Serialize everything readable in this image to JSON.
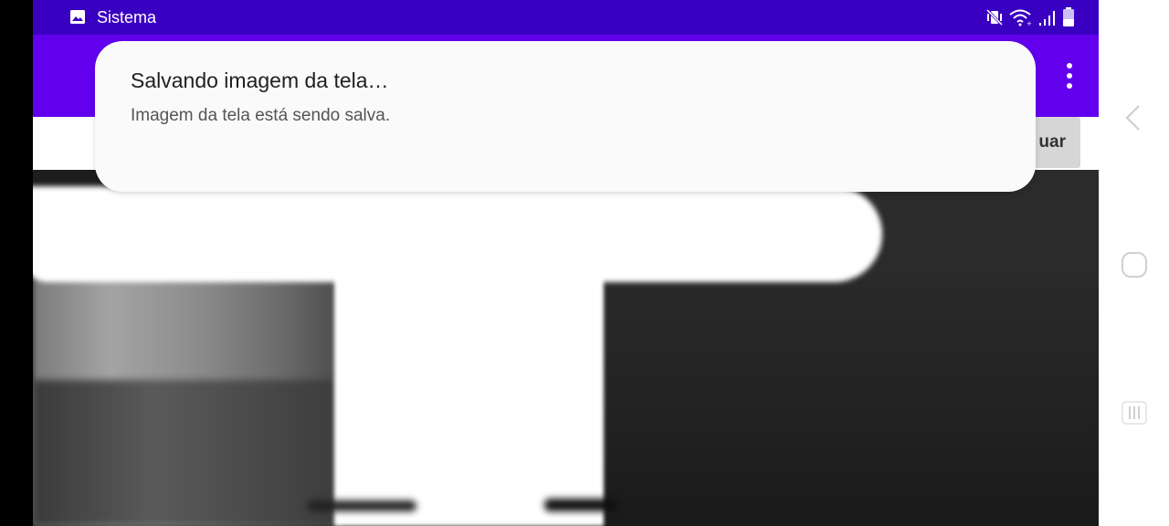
{
  "status_bar": {
    "app_name": "Sistema",
    "background_color": "#3a00c2",
    "icons": [
      "gallery-icon",
      "vibrate-mute-icon",
      "wifi-icon",
      "signal-icon",
      "battery-icon"
    ]
  },
  "app_bar": {
    "background_color": "#6200ee",
    "menu_icon": "more-vert-icon"
  },
  "toolbar": {
    "action_label": "uar"
  },
  "notification": {
    "title": "Salvando imagem da tela…",
    "text": "Imagem da tela está sendo salva."
  },
  "nav_bar": {
    "icons": [
      "back-icon",
      "home-icon",
      "recent-apps-icon"
    ]
  }
}
